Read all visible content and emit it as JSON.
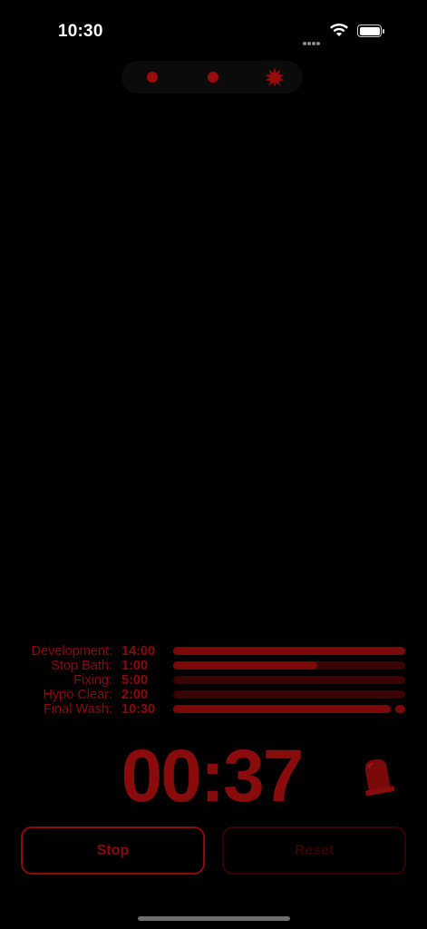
{
  "status_bar": {
    "time": "10:30"
  },
  "page_indicator": {
    "pages": 3,
    "current_index": 2
  },
  "steps": [
    {
      "label": "Development:",
      "duration": "14:00",
      "progress": 1.0
    },
    {
      "label": "Stop Bath:",
      "duration": "1:00",
      "progress": 0.62
    },
    {
      "label": "Fixing:",
      "duration": "5:00",
      "progress": 0.0
    },
    {
      "label": "Hypo Clear:",
      "duration": "2:00",
      "progress": 0.0
    },
    {
      "label": "Final Wash:",
      "duration": "10:30",
      "progress": 1.0
    }
  ],
  "timer": {
    "value": "00:37"
  },
  "buttons": {
    "stop_label": "Stop",
    "reset_label": "Reset"
  },
  "icons": {
    "alarm": "bell-icon",
    "active_page": "starburst-icon"
  },
  "colors": {
    "accent": "#8a0b0b",
    "track": "#3a0404",
    "background": "#000000"
  }
}
